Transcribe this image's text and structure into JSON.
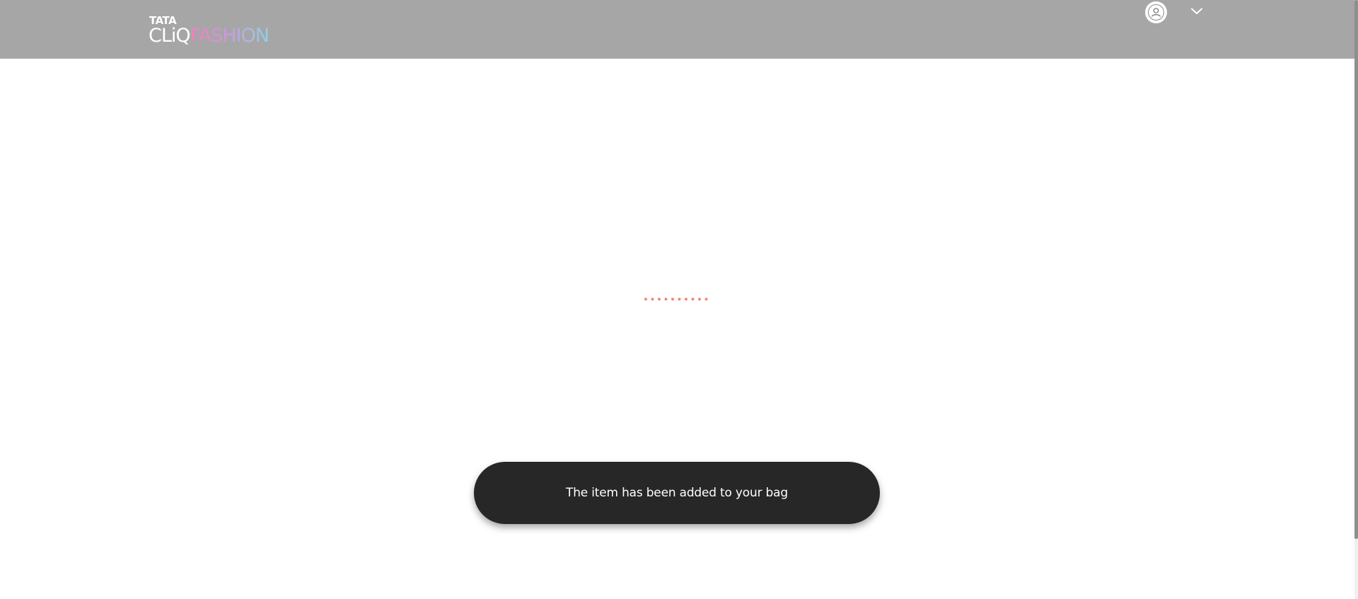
{
  "header": {
    "logo": {
      "tata": "TATA",
      "cliq": "CLiQ",
      "fashion": "FASHION"
    },
    "account_icon": "user-account-icon",
    "menu_icon": "chevron-down-icon"
  },
  "main": {
    "loader_icon": "loading-dots-icon"
  },
  "toast": {
    "message": "The item has been added to your bag"
  },
  "colors": {
    "header_bg": "#a6a6a6",
    "loader_dot": "#f08a7b",
    "toast_bg": "#272727",
    "toast_text": "#ffffff"
  }
}
